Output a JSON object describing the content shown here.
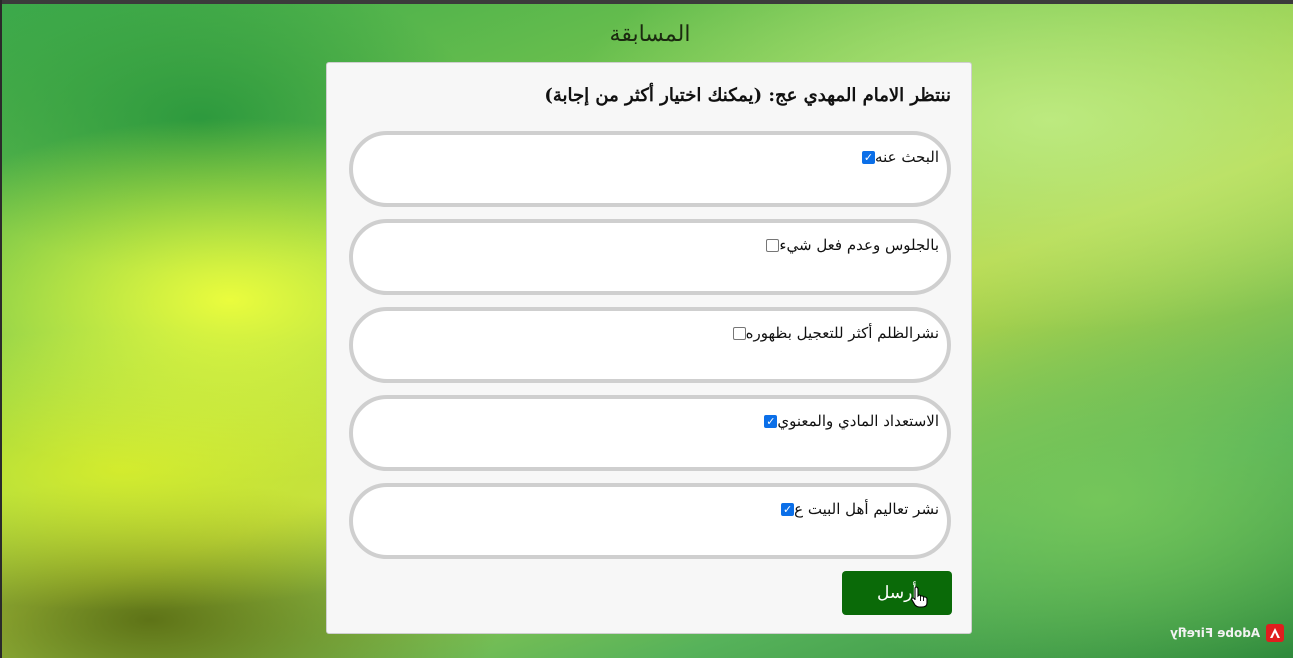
{
  "page": {
    "title": "المسابقة"
  },
  "quiz": {
    "question": "ننتظر الامام المهدي عج: (يمكنك اختيار أكثر من إجابة)",
    "options": [
      {
        "label": "البحث عنه",
        "checked": true
      },
      {
        "label": "بالجلوس وعدم فعل شيء",
        "checked": false
      },
      {
        "label": "نشرالظلم أكثر للتعجيل بظهوره",
        "checked": false
      },
      {
        "label": "الاستعداد المادي والمعنوي",
        "checked": true
      },
      {
        "label": "نشر تعاليم أهل البيت ع",
        "checked": true
      }
    ],
    "submit_label": "أرسل"
  },
  "watermark": {
    "text": "Adobe Firefly",
    "logo_icon": "adobe-logo-icon"
  },
  "colors": {
    "submit_bg": "#0a6a08",
    "checkbox_checked": "#0b6fe8",
    "option_border": "#cfcfcf",
    "card_bg": "#f7f7f7"
  }
}
